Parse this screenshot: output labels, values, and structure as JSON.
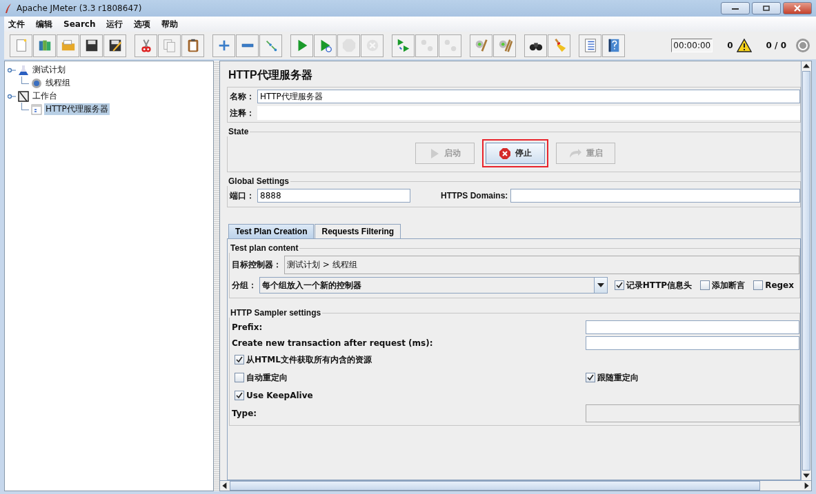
{
  "window": {
    "title": "Apache JMeter (3.3 r1808647)"
  },
  "menu": [
    "文件",
    "编辑",
    "Search",
    "运行",
    "选项",
    "帮助"
  ],
  "toolbar": {
    "buttons": [
      {
        "disabled": false
      },
      {
        "disabled": false
      },
      {
        "disabled": false
      },
      {
        "disabled": false
      },
      {
        "disabled": false
      },
      {
        "disabled": false
      },
      {
        "disabled": false
      },
      {
        "disabled": false
      },
      {
        "disabled": false
      },
      {
        "disabled": false
      },
      {
        "disabled": false
      },
      {
        "disabled": false
      },
      {
        "disabled": false
      },
      {
        "disabled": true
      },
      {
        "disabled": true
      },
      {
        "disabled": false
      },
      {
        "disabled": true
      },
      {
        "disabled": true
      },
      {
        "disabled": false
      },
      {
        "disabled": false
      },
      {
        "disabled": false
      },
      {
        "disabled": false
      },
      {
        "disabled": false
      },
      {
        "disabled": false
      }
    ],
    "timer": "00:00:00",
    "warnings": "0",
    "threads": "0 / 0"
  },
  "tree": [
    {
      "label": "测试计划",
      "kind": "plan",
      "selected": false,
      "children": [
        {
          "label": "线程组",
          "kind": "gear",
          "selected": false
        }
      ]
    },
    {
      "label": "工作台",
      "kind": "bench",
      "selected": false,
      "children": [
        {
          "label": "HTTP代理服务器",
          "kind": "proxy",
          "selected": true
        }
      ]
    }
  ],
  "panel": {
    "title": "HTTP代理服务器",
    "name_label": "名称：",
    "name_value": "HTTP代理服务器",
    "comment_label": "注释：",
    "state": {
      "legend": "State",
      "buttons": [
        {
          "label": "启动",
          "kind": "start",
          "disabled": true,
          "highlighted": false
        },
        {
          "label": "停止",
          "kind": "stop",
          "disabled": false,
          "highlighted": true
        },
        {
          "label": "重启",
          "kind": "restart",
          "disabled": true,
          "highlighted": false
        }
      ]
    },
    "global": {
      "legend": "Global Settings",
      "port_label": "端口：",
      "port_value": "8888",
      "https_label": "HTTPS Domains:"
    },
    "tabs": [
      {
        "label": "Test Plan Creation",
        "selected": true
      },
      {
        "label": "Requests Filtering",
        "selected": false
      }
    ],
    "content": {
      "legend": "Test plan content",
      "target_label": "目标控制器：",
      "target_value": "测试计划 > 线程组",
      "group_label": "分组：",
      "group_value": "每个组放入一个新的控制器",
      "options": [
        {
          "label": "记录HTTP信息头",
          "checked": true
        },
        {
          "label": "添加断言",
          "checked": false
        },
        {
          "label": "Regex",
          "checked": false
        }
      ]
    },
    "sampler": {
      "legend": "HTTP Sampler settings",
      "prefix_label": "Prefix:",
      "transaction_label": "Create new transaction after request (ms):",
      "fetch": {
        "label": "从HTML文件获取所有内含的资源",
        "checked": true
      },
      "auto_redirect": {
        "label": "自动重定向",
        "checked": false
      },
      "follow_redirect": {
        "label": "跟随重定向",
        "checked": true
      },
      "keepalive": {
        "label": "Use KeepAlive",
        "checked": true
      },
      "type_label": "Type:"
    }
  }
}
